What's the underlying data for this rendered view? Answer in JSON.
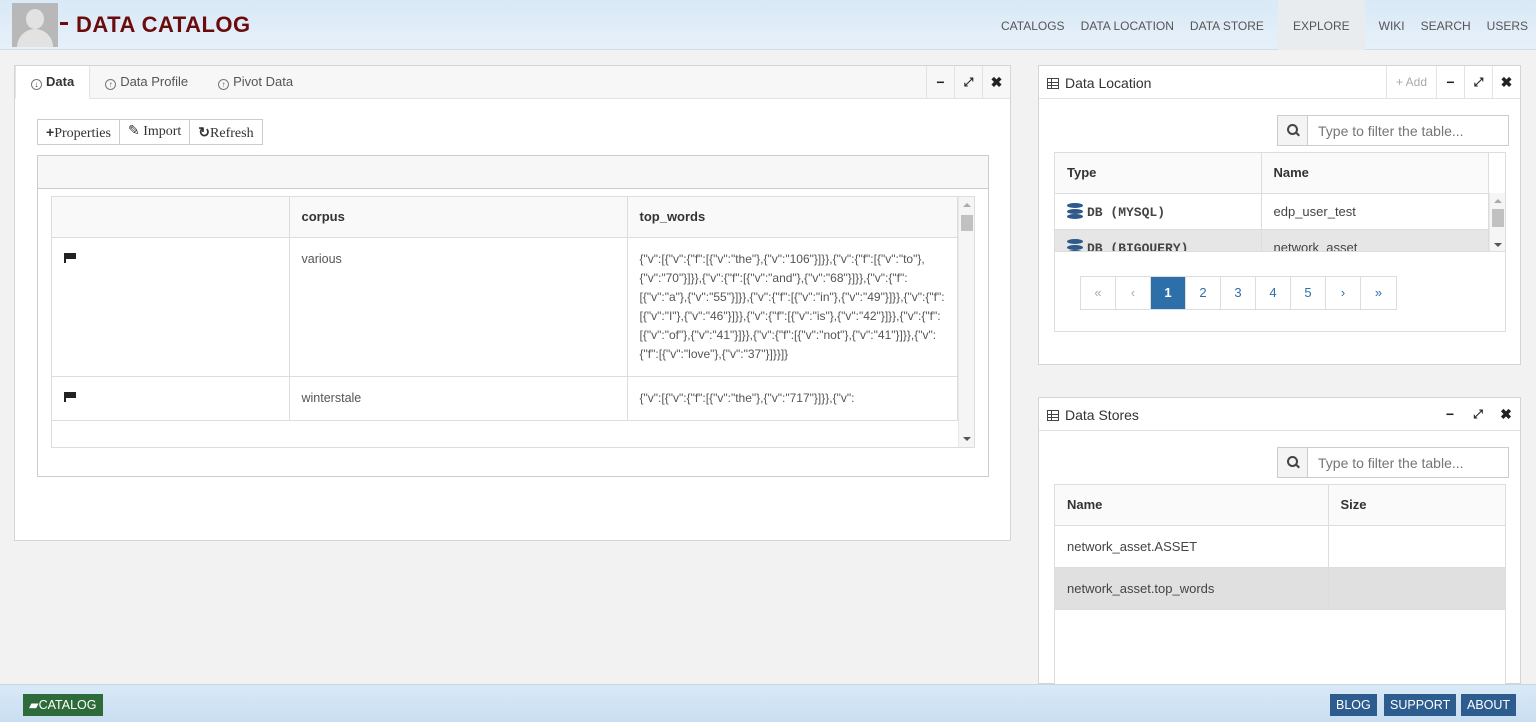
{
  "header": {
    "brand": "DATA CATALOG",
    "nav": [
      "CATALOGS",
      "DATA LOCATION",
      "DATA STORE",
      "EXPLORE",
      "WIKI",
      "SEARCH",
      "USERS"
    ],
    "active_nav": "EXPLORE"
  },
  "data_panel": {
    "tabs": [
      {
        "label": "Data",
        "icon": "circle-arrow-down-icon",
        "active": true
      },
      {
        "label": "Data Profile",
        "icon": "circle-arrow-up-icon",
        "active": false
      },
      {
        "label": "Pivot Data",
        "icon": "circle-arrow-up-icon",
        "active": false
      }
    ],
    "buttons": {
      "properties": "Properties",
      "import": "Import",
      "refresh": "Refresh"
    },
    "grid": {
      "headers": [
        "",
        "corpus",
        "top_words"
      ],
      "rows": [
        {
          "flag": "flag-icon",
          "corpus": "various",
          "top_words": "{\"v\":[{\"v\":{\"f\":[{\"v\":\"the\"},{\"v\":\"106\"}]}},{\"v\":{\"f\":[{\"v\":\"to\"},{\"v\":\"70\"}]}},{\"v\":{\"f\":[{\"v\":\"and\"},{\"v\":\"68\"}]}},{\"v\":{\"f\":[{\"v\":\"a\"},{\"v\":\"55\"}]}},{\"v\":{\"f\":[{\"v\":\"in\"},{\"v\":\"49\"}]}},{\"v\":{\"f\":[{\"v\":\"I\"},{\"v\":\"46\"}]}},{\"v\":{\"f\":[{\"v\":\"is\"},{\"v\":\"42\"}]}},{\"v\":{\"f\":[{\"v\":\"of\"},{\"v\":\"41\"}]}},{\"v\":{\"f\":[{\"v\":\"not\"},{\"v\":\"41\"}]}},{\"v\":{\"f\":[{\"v\":\"love\"},{\"v\":\"37\"}]}}]}"
        },
        {
          "flag": "flag-icon",
          "corpus": "winterstale",
          "top_words": "{\"v\":[{\"v\":{\"f\":[{\"v\":\"the\"},{\"v\":\"717\"}]}},{\"v\":"
        }
      ]
    }
  },
  "location_panel": {
    "title": "Data Location",
    "add_label": "Add",
    "search_placeholder": "Type to filter the table...",
    "headers": [
      "Type",
      "Name"
    ],
    "rows": [
      {
        "type": "DB (MYSQL)",
        "name": "edp_user_test"
      },
      {
        "type": "DB (BIGQUERY)",
        "name": "network_asset"
      }
    ],
    "pager": [
      "«",
      "‹",
      "1",
      "2",
      "3",
      "4",
      "5",
      "›",
      "»"
    ],
    "current_page": "1"
  },
  "stores_panel": {
    "title": "Data Stores",
    "search_placeholder": "Type to filter the table...",
    "headers": [
      "Name",
      "Size"
    ],
    "rows": [
      {
        "name": "network_asset.ASSET",
        "size": ""
      },
      {
        "name": "network_asset.top_words",
        "size": ""
      }
    ]
  },
  "footer": {
    "catalog": "CATALOG",
    "blog": "BLOG",
    "support": "SUPPORT",
    "about": "ABOUT"
  },
  "colors": {
    "brand": "#6b0b0b",
    "link": "#2d6fa8",
    "db_type": "#2d5a8a",
    "footer_green": "#2e6b3a",
    "footer_blue": "#2d5c8f"
  }
}
